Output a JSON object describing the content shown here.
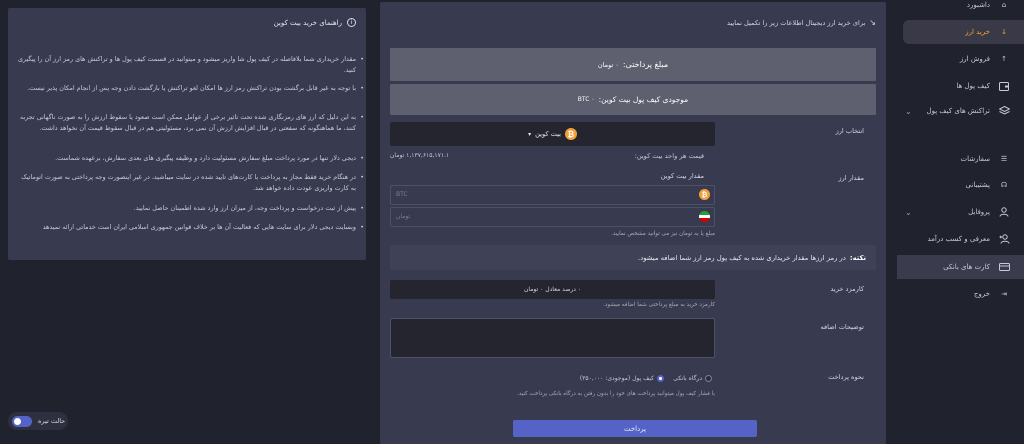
{
  "sidebar": {
    "items": [
      {
        "label": "داشبورد",
        "icon": "home-icon"
      },
      {
        "label": "خرید ارز",
        "icon": "arrow-down-icon",
        "active": true
      },
      {
        "label": "فروش ارز",
        "icon": "arrow-up-icon"
      },
      {
        "label": "کیف پول ها",
        "icon": "wallet-icon"
      },
      {
        "label": "تراکنش های کیف پول",
        "icon": "layers-icon"
      },
      {
        "label": "سفارشات",
        "icon": "list-icon"
      },
      {
        "label": "پشتیبانی",
        "icon": "headset-icon"
      },
      {
        "label": "پروفایل",
        "icon": "user-icon"
      },
      {
        "label": "معرفی و کسب درآمد",
        "icon": "user-plus-icon"
      },
      {
        "label": "کارت های بانکی",
        "icon": "card-icon"
      },
      {
        "label": "خروج",
        "icon": "logout-icon"
      }
    ]
  },
  "theme_toggle": {
    "label": "حالت تیره"
  },
  "guide": {
    "title": "راهنمای خرید بیت کوین",
    "bullets": [
      "مقدار خریداری شما بلافاصله در کیف پول شا واریز میشود و میتوانید در قسمت کیف پول ها و تراکنش های رمز ارز آن را پیگیری کنید.",
      "با توجه به غیر قابل برگشت بودن تراکنش رمز ارز ها امکان لغو تراکنش یا بازگشت دادن وجه پس از انجام امکان پذیر نیست.",
      "به این دلیل که ارز های رمزنگاری شده تحت تاثیر برخی از عوامل ممکن است صعود یا سقوط ارزش را به صورت ناگهانی تجربه کنند، ما هماهنگونه که سفعتی در قبال افزایش ارزش آن نمی برد، مسئولیتی هم در قبال سقوط قیمت آن نخواهد داشت.",
      "دیجی دلار تنها در مورد پرداخت مبلغ سفارش مسئولیت دارد و وظیفه پیگیری های بعدی سفارش، برعهده شماست.",
      "در هنگام خرید فقط مجاز به پرداخت با کارت‌های تایید شده در سایت میباشید، در غیر اینصورت وجه پرداختی به صورت اتوماتیک به کارت واریزی عودت داده خواهد شد.",
      "پیش از ثبت درخواست و پرداخت وجه، از میزان ارز وارد شده اطمینان حاصل نمایید.",
      "وبسایت دیجی دلار برای سایت هایی که فعالیت آن ها بر خلاف قوانین جمهوری اسلامی ایران است خدماتی ارائه نمیدهد"
    ]
  },
  "main": {
    "intro": "برای خرید ارز دیجیتال اطلاعات زیر را تکمیل نمایید",
    "payment_label": "مبلغ پرداختی:",
    "payment_value": "۰ تومان",
    "balance_label": "موجودی کیف پول بیت کوین:",
    "balance_value": "۰ BTC",
    "currency_label": "انتخاب ارز",
    "currency_selected": "بیت کوین",
    "unit_price_label": "قیمت هر واحد بیت کوین:",
    "unit_price_value": "۱,۱۳۷,۶۱۵,۱۷۱.۱ تومان",
    "amount_label": "مقدار ارز",
    "amount_sub_label": "مقدار بیت کوین",
    "btc_placeholder": "BTC",
    "toman_placeholder": "تومان",
    "amount_hint": "مبلغ یا به تومان نیز می توانید مشخص نمایید.",
    "note_label": "نکته:",
    "note_text": "در رمز ارزها مقدار خریداری شده به کیف پول رمز ارز شما اضافه میشود.",
    "fee_label": "کارمزد خرید",
    "fee_value": "۰ درصد معادل ۰ تومان",
    "fee_hint": "کارمزد خرید به مبلغ پرداختی شما اضافه میشود.",
    "notes_label": "توضیحات اضافه",
    "method_label": "نحوه پرداخت",
    "method_gateway": "درگاه بانکی",
    "method_wallet": "کیف پول (موجودی: ۳۵۰,۰۰۰)",
    "method_hint": "با فشار کیف پول میتوانید پرداخت های خود را بدون رفتن به درگاه بانکی پرداخت کنید.",
    "pay_button": "پرداخت"
  },
  "colors": {
    "accent": "#f0a43a",
    "primary": "#5563c7",
    "panel": "#383a4f",
    "background": "#20222e"
  }
}
